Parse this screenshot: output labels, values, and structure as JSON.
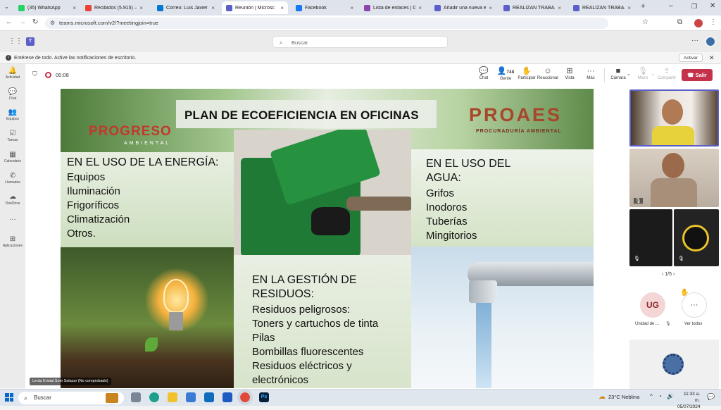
{
  "browser": {
    "tabs": [
      {
        "label": "(35) WhatsApp",
        "color": "#25d366"
      },
      {
        "label": "Recibidos (5.915) – m",
        "color": "#ea4335"
      },
      {
        "label": "Correo: Luis Javier Pr",
        "color": "#0078d4"
      },
      {
        "label": "Reunión | Microsc",
        "color": "#5b5fc7",
        "active": true
      },
      {
        "label": "Facebook",
        "color": "#1877f2"
      },
      {
        "label": "Lista de enlaces | Go",
        "color": "#8e44ad"
      },
      {
        "label": "Añadir una nueva en",
        "color": "#5b5fc7"
      },
      {
        "label": "REALIZAN TRABAJOS",
        "color": "#5b5fc7"
      },
      {
        "label": "REALIZAN TRABAJOS",
        "color": "#5b5fc7"
      }
    ],
    "url": "teams.microsoft.com/v2/?meetingjoin=true"
  },
  "teams": {
    "search_placeholder": "Buscar",
    "notification": "Entérese de todo. Active las notificaciones de escritorio.",
    "activate_label": "Activar",
    "rail": [
      {
        "icon": "bell-icon",
        "label": "Actividad"
      },
      {
        "icon": "chat-icon",
        "label": "Chat"
      },
      {
        "icon": "teams-icon",
        "label": "Equipos"
      },
      {
        "icon": "tasks-icon",
        "label": "Tareas"
      },
      {
        "icon": "calendar-icon",
        "label": "Calendario"
      },
      {
        "icon": "phone-icon",
        "label": "Llamadas"
      },
      {
        "icon": "cloud-icon",
        "label": "OneDrive"
      },
      {
        "icon": "more-icon",
        "label": "..."
      },
      {
        "icon": "apps-icon",
        "label": "Aplicaciones"
      }
    ],
    "timer": "00:08",
    "toolbar": {
      "chat": "Chat",
      "people_count": "748",
      "people": "Gente",
      "raise": "Participar",
      "react": "Reaccionar",
      "view": "Vista",
      "more": "Más",
      "camera": "Cámara",
      "mic": "Micro",
      "share": "Compartir",
      "leave": "Salir"
    },
    "presenter_name": "Linda Kristal Soto Salazar (No comprobado)",
    "pagination": "1/5",
    "participant_initials": "UG",
    "participant_name": "Unidad de ...",
    "view_all": "Ver todos"
  },
  "slide": {
    "title": "PLAN DE ECOEFICIENCIA EN OFICINAS",
    "logo_left": "PROGRESO",
    "logo_left_sub": "AMBIENTAL",
    "logo_right": "PROAES",
    "logo_right_sub": "PROCURADURÍA AMBIENTAL",
    "energy_heading": "EN EL USO DE LA ENERGÍA:",
    "energy_items": [
      "Equipos",
      "Iluminación",
      "Frigoríficos",
      "Climatización",
      "Otros."
    ],
    "water_heading_1": "EN EL USO DEL",
    "water_heading_2": "AGUA:",
    "water_items": [
      "Grifos",
      "Inodoros",
      "Tuberías",
      "Mingitorios"
    ],
    "waste_heading_1": "EN LA GESTIÓN DE",
    "waste_heading_2": "RESIDUOS:",
    "waste_items": [
      "Residuos peligrosos:",
      "Toners y cartuchos de tinta",
      "Pilas",
      "Bombillas fluorescentes",
      "Residuos eléctricos y",
      "electrónicos"
    ]
  },
  "taskbar": {
    "search": "Buscar",
    "weather": "23°C  Neblina",
    "time": "11:33 a. m.",
    "date": "05/07/2024"
  }
}
